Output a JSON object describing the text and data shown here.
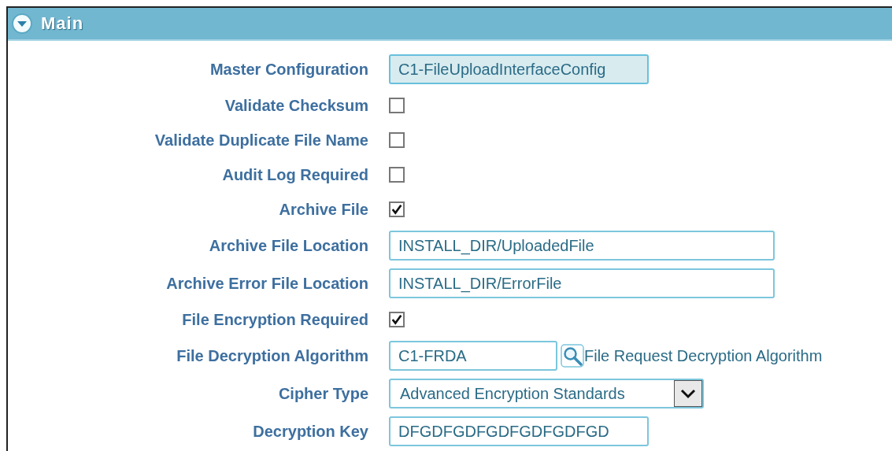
{
  "section": {
    "title": "Main",
    "expanded": true
  },
  "fields": [
    {
      "label": "Master Configuration",
      "kind": "text",
      "value": "C1-FileUploadInterfaceConfig",
      "readonly": true
    },
    {
      "label": "Validate Checksum",
      "kind": "checkbox",
      "checked": false
    },
    {
      "label": "Validate Duplicate File Name",
      "kind": "checkbox",
      "checked": false
    },
    {
      "label": "Audit Log Required",
      "kind": "checkbox",
      "checked": false
    },
    {
      "label": "Archive File",
      "kind": "checkbox",
      "checked": true
    },
    {
      "label": "Archive File Location",
      "kind": "text",
      "value": "INSTALL_DIR/UploadedFile",
      "readonly": false
    },
    {
      "label": "Archive Error File Location",
      "kind": "text",
      "value": "INSTALL_DIR/ErrorFile",
      "readonly": false
    },
    {
      "label": "File Encryption Required",
      "kind": "checkbox",
      "checked": true
    },
    {
      "label": "File Decryption Algorithm",
      "kind": "lookup",
      "value": "C1-FRDA",
      "description": "File Request Decryption Algorithm"
    },
    {
      "label": "Cipher Type",
      "kind": "select",
      "value": "Advanced Encryption Standards"
    },
    {
      "label": "Decryption Key",
      "kind": "text",
      "value": "DFGDFGDFGDFGDFGDFGD",
      "readonly": false
    }
  ]
}
